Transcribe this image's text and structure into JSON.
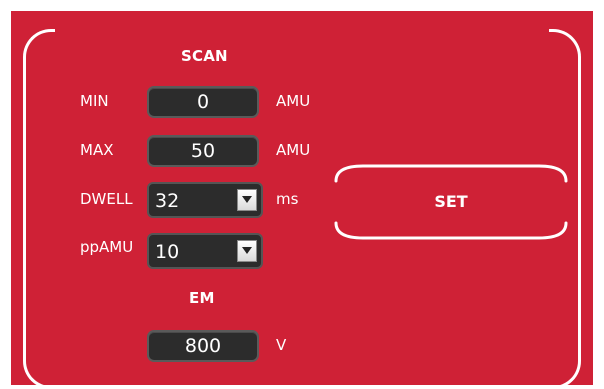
{
  "colors": {
    "panel": "#cf2136",
    "field": "#2c2c2c",
    "text": "#ffffff"
  },
  "scan": {
    "header": "SCAN",
    "min": {
      "label": "MIN",
      "value": "0",
      "unit": "AMU"
    },
    "max": {
      "label": "MAX",
      "value": "50",
      "unit": "AMU"
    },
    "dwell": {
      "label": "DWELL",
      "value": "32",
      "unit": "ms"
    },
    "ppamu": {
      "label": "ppAMU",
      "value": "10"
    }
  },
  "em": {
    "header": "EM",
    "value": "800",
    "unit": "V"
  },
  "set_button": {
    "label": "SET"
  },
  "icons": {
    "dropdown": "chevron-down-icon"
  }
}
